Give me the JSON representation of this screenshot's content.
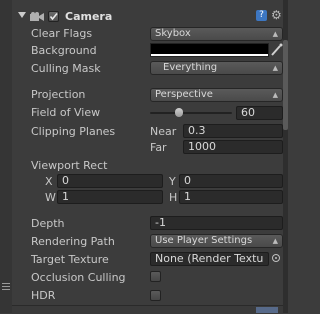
{
  "header": {
    "title": "Camera",
    "enabled": true
  },
  "fields": {
    "clear_flags": {
      "label": "Clear Flags",
      "value": "Skybox"
    },
    "background": {
      "label": "Background",
      "color": "#000000"
    },
    "culling_mask": {
      "label": "Culling Mask",
      "value": "Everything"
    },
    "projection": {
      "label": "Projection",
      "value": "Perspective"
    },
    "fov": {
      "label": "Field of View",
      "value": "60",
      "level": 0.34
    },
    "clipping": {
      "label": "Clipping Planes",
      "near_label": "Near",
      "near": "0.3",
      "far_label": "Far",
      "far": "1000"
    },
    "viewport": {
      "label": "Viewport Rect",
      "x_label": "X",
      "x": "0",
      "y_label": "Y",
      "y": "0",
      "w_label": "W",
      "w": "1",
      "h_label": "H",
      "h": "1"
    },
    "depth": {
      "label": "Depth",
      "value": "-1"
    },
    "rendering_path": {
      "label": "Rendering Path",
      "value": "Use Player Settings"
    },
    "target_texture": {
      "label": "Target Texture",
      "value": "None (Render Textu"
    },
    "occlusion": {
      "label": "Occlusion Culling",
      "checked": false
    },
    "hdr": {
      "label": "HDR",
      "checked": false
    }
  },
  "icons": [
    "fold-arrow-icon",
    "camera-component-icon",
    "help-icon",
    "gear-icon",
    "color-picker-icon",
    "object-picker-icon"
  ]
}
